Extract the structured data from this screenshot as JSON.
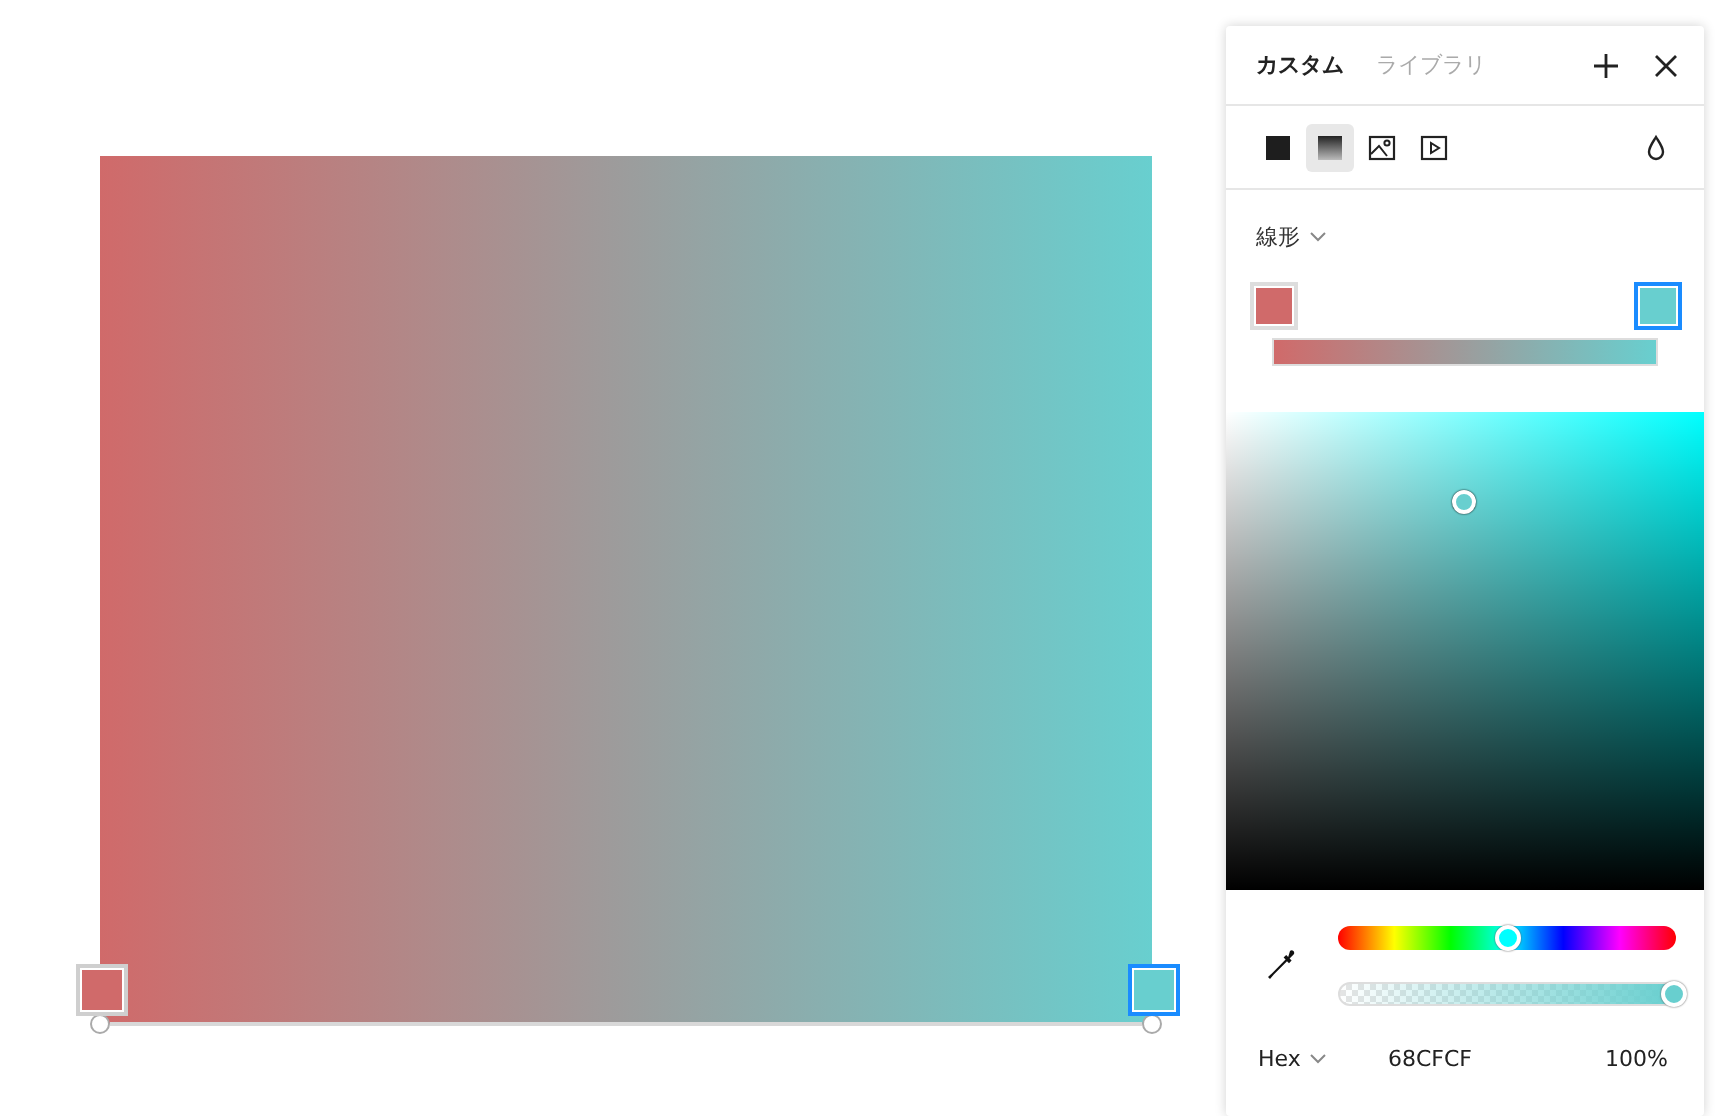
{
  "canvas": {
    "stops": [
      {
        "color": "#d06a6a",
        "selected": false
      },
      {
        "color": "#68cfcf",
        "selected": true
      }
    ]
  },
  "panel": {
    "tabs": [
      {
        "label": "カスタム",
        "selected": true
      },
      {
        "label": "ライブラリ",
        "selected": false
      }
    ],
    "fill_types": [
      {
        "kind": "solid",
        "selected": false
      },
      {
        "kind": "gradient",
        "selected": true
      },
      {
        "kind": "image",
        "selected": false
      },
      {
        "kind": "video",
        "selected": false
      }
    ],
    "gradient_type": "線形",
    "stops": [
      {
        "color": "#d06a6a",
        "selected": false
      },
      {
        "color": "#68cfcf",
        "selected": true
      }
    ],
    "hue": {
      "level": 0.5
    },
    "alpha": {
      "level": 1
    },
    "format": "Hex",
    "hex": "68CFCF",
    "opacity": "100%"
  }
}
